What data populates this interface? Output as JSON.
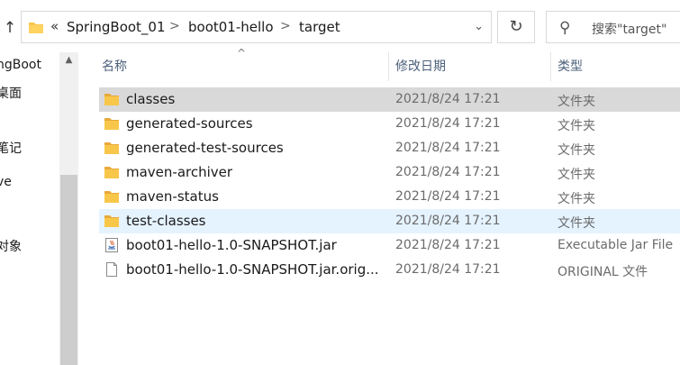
{
  "address_bar": {
    "overflow": "«",
    "crumbs": [
      "SpringBoot_01",
      "boot01-hello",
      "target"
    ],
    "separator": ">"
  },
  "search": {
    "placeholder": "搜索\"target\""
  },
  "nav": {
    "items": [
      "ngBoot",
      "桌面",
      "笔记",
      "ve",
      "对象"
    ]
  },
  "columns": {
    "name": "名称",
    "modified": "修改日期",
    "type": "类型"
  },
  "files": [
    {
      "name": "classes",
      "modified": "2021/8/24 17:21",
      "type": "文件夹",
      "icon": "folder-icon",
      "state": "selected"
    },
    {
      "name": "generated-sources",
      "modified": "2021/8/24 17:21",
      "type": "文件夹",
      "icon": "folder-icon",
      "state": ""
    },
    {
      "name": "generated-test-sources",
      "modified": "2021/8/24 17:21",
      "type": "文件夹",
      "icon": "folder-icon",
      "state": ""
    },
    {
      "name": "maven-archiver",
      "modified": "2021/8/24 17:21",
      "type": "文件夹",
      "icon": "folder-icon",
      "state": ""
    },
    {
      "name": "maven-status",
      "modified": "2021/8/24 17:21",
      "type": "文件夹",
      "icon": "folder-icon",
      "state": ""
    },
    {
      "name": "test-classes",
      "modified": "2021/8/24 17:21",
      "type": "文件夹",
      "icon": "folder-icon",
      "state": "hover"
    },
    {
      "name": "boot01-hello-1.0-SNAPSHOT.jar",
      "modified": "2021/8/24 17:21",
      "type": "Executable Jar File",
      "icon": "jar-icon",
      "state": ""
    },
    {
      "name": "boot01-hello-1.0-SNAPSHOT.jar.orig...",
      "modified": "2021/8/24 17:21",
      "type": "ORIGINAL 文件",
      "icon": "file-icon",
      "state": ""
    }
  ],
  "colors": {
    "folder": "#f8c74a",
    "selected_row": "#d9d9d9",
    "hover_row": "#e5f3ff",
    "header_text": "#4c607a"
  }
}
